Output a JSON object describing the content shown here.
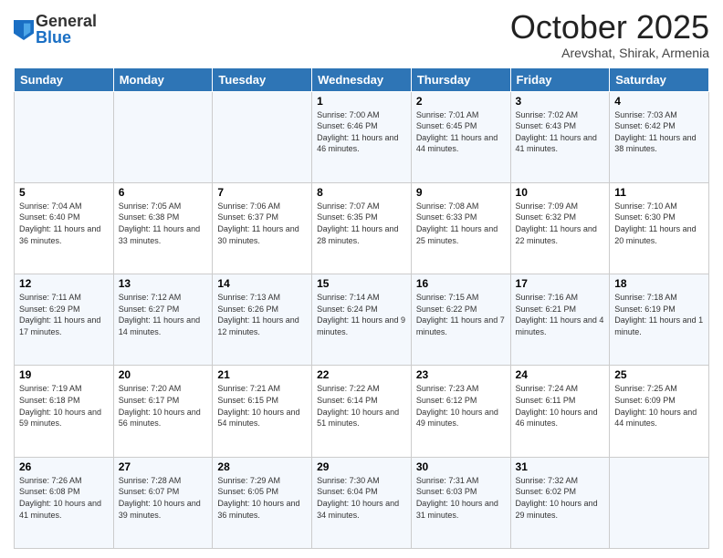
{
  "logo": {
    "general": "General",
    "blue": "Blue"
  },
  "header": {
    "month": "October 2025",
    "location": "Arevshat, Shirak, Armenia"
  },
  "days_of_week": [
    "Sunday",
    "Monday",
    "Tuesday",
    "Wednesday",
    "Thursday",
    "Friday",
    "Saturday"
  ],
  "weeks": [
    [
      {
        "day": "",
        "info": ""
      },
      {
        "day": "",
        "info": ""
      },
      {
        "day": "",
        "info": ""
      },
      {
        "day": "1",
        "info": "Sunrise: 7:00 AM\nSunset: 6:46 PM\nDaylight: 11 hours and 46 minutes."
      },
      {
        "day": "2",
        "info": "Sunrise: 7:01 AM\nSunset: 6:45 PM\nDaylight: 11 hours and 44 minutes."
      },
      {
        "day": "3",
        "info": "Sunrise: 7:02 AM\nSunset: 6:43 PM\nDaylight: 11 hours and 41 minutes."
      },
      {
        "day": "4",
        "info": "Sunrise: 7:03 AM\nSunset: 6:42 PM\nDaylight: 11 hours and 38 minutes."
      }
    ],
    [
      {
        "day": "5",
        "info": "Sunrise: 7:04 AM\nSunset: 6:40 PM\nDaylight: 11 hours and 36 minutes."
      },
      {
        "day": "6",
        "info": "Sunrise: 7:05 AM\nSunset: 6:38 PM\nDaylight: 11 hours and 33 minutes."
      },
      {
        "day": "7",
        "info": "Sunrise: 7:06 AM\nSunset: 6:37 PM\nDaylight: 11 hours and 30 minutes."
      },
      {
        "day": "8",
        "info": "Sunrise: 7:07 AM\nSunset: 6:35 PM\nDaylight: 11 hours and 28 minutes."
      },
      {
        "day": "9",
        "info": "Sunrise: 7:08 AM\nSunset: 6:33 PM\nDaylight: 11 hours and 25 minutes."
      },
      {
        "day": "10",
        "info": "Sunrise: 7:09 AM\nSunset: 6:32 PM\nDaylight: 11 hours and 22 minutes."
      },
      {
        "day": "11",
        "info": "Sunrise: 7:10 AM\nSunset: 6:30 PM\nDaylight: 11 hours and 20 minutes."
      }
    ],
    [
      {
        "day": "12",
        "info": "Sunrise: 7:11 AM\nSunset: 6:29 PM\nDaylight: 11 hours and 17 minutes."
      },
      {
        "day": "13",
        "info": "Sunrise: 7:12 AM\nSunset: 6:27 PM\nDaylight: 11 hours and 14 minutes."
      },
      {
        "day": "14",
        "info": "Sunrise: 7:13 AM\nSunset: 6:26 PM\nDaylight: 11 hours and 12 minutes."
      },
      {
        "day": "15",
        "info": "Sunrise: 7:14 AM\nSunset: 6:24 PM\nDaylight: 11 hours and 9 minutes."
      },
      {
        "day": "16",
        "info": "Sunrise: 7:15 AM\nSunset: 6:22 PM\nDaylight: 11 hours and 7 minutes."
      },
      {
        "day": "17",
        "info": "Sunrise: 7:16 AM\nSunset: 6:21 PM\nDaylight: 11 hours and 4 minutes."
      },
      {
        "day": "18",
        "info": "Sunrise: 7:18 AM\nSunset: 6:19 PM\nDaylight: 11 hours and 1 minute."
      }
    ],
    [
      {
        "day": "19",
        "info": "Sunrise: 7:19 AM\nSunset: 6:18 PM\nDaylight: 10 hours and 59 minutes."
      },
      {
        "day": "20",
        "info": "Sunrise: 7:20 AM\nSunset: 6:17 PM\nDaylight: 10 hours and 56 minutes."
      },
      {
        "day": "21",
        "info": "Sunrise: 7:21 AM\nSunset: 6:15 PM\nDaylight: 10 hours and 54 minutes."
      },
      {
        "day": "22",
        "info": "Sunrise: 7:22 AM\nSunset: 6:14 PM\nDaylight: 10 hours and 51 minutes."
      },
      {
        "day": "23",
        "info": "Sunrise: 7:23 AM\nSunset: 6:12 PM\nDaylight: 10 hours and 49 minutes."
      },
      {
        "day": "24",
        "info": "Sunrise: 7:24 AM\nSunset: 6:11 PM\nDaylight: 10 hours and 46 minutes."
      },
      {
        "day": "25",
        "info": "Sunrise: 7:25 AM\nSunset: 6:09 PM\nDaylight: 10 hours and 44 minutes."
      }
    ],
    [
      {
        "day": "26",
        "info": "Sunrise: 7:26 AM\nSunset: 6:08 PM\nDaylight: 10 hours and 41 minutes."
      },
      {
        "day": "27",
        "info": "Sunrise: 7:28 AM\nSunset: 6:07 PM\nDaylight: 10 hours and 39 minutes."
      },
      {
        "day": "28",
        "info": "Sunrise: 7:29 AM\nSunset: 6:05 PM\nDaylight: 10 hours and 36 minutes."
      },
      {
        "day": "29",
        "info": "Sunrise: 7:30 AM\nSunset: 6:04 PM\nDaylight: 10 hours and 34 minutes."
      },
      {
        "day": "30",
        "info": "Sunrise: 7:31 AM\nSunset: 6:03 PM\nDaylight: 10 hours and 31 minutes."
      },
      {
        "day": "31",
        "info": "Sunrise: 7:32 AM\nSunset: 6:02 PM\nDaylight: 10 hours and 29 minutes."
      },
      {
        "day": "",
        "info": ""
      }
    ]
  ]
}
